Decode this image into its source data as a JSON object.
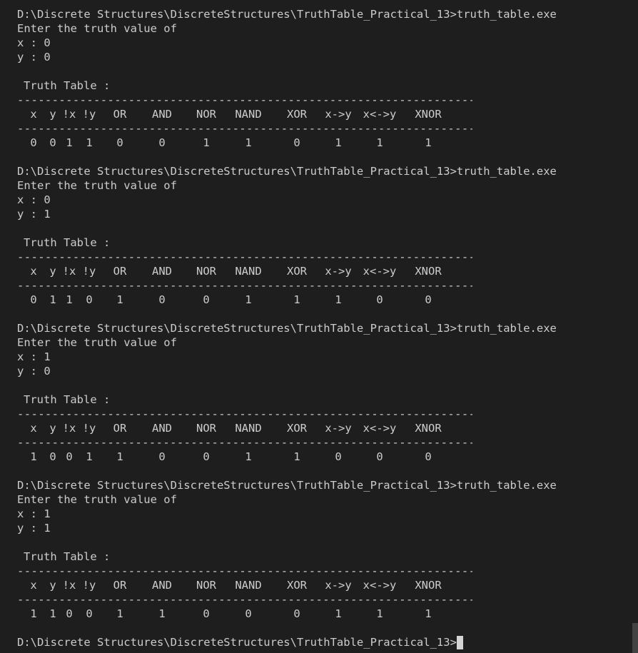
{
  "terminal": {
    "prompt": "D:\\Discrete Structures\\DiscreteStructures\\TruthTable_Practical_13>",
    "command": "truth_table.exe",
    "enter_prompt": "Enter the truth value of",
    "x_label": "x : ",
    "y_label": "y : ",
    "table_title": "Truth Table :",
    "separator": "------------------------------------------------------------------------------------------------------------",
    "headers": [
      "x",
      "y",
      "!x",
      "!y",
      "OR",
      "AND",
      "NOR",
      "NAND",
      "XOR",
      "x->y",
      "x<->y",
      "XNOR"
    ],
    "runs": [
      {
        "x": "0",
        "y": "0",
        "row": [
          "0",
          "0",
          "1",
          "1",
          "0",
          "0",
          "1",
          "1",
          "0",
          "1",
          "1",
          "1"
        ]
      },
      {
        "x": "0",
        "y": "1",
        "row": [
          "0",
          "1",
          "1",
          "0",
          "1",
          "0",
          "0",
          "1",
          "1",
          "1",
          "0",
          "0"
        ]
      },
      {
        "x": "1",
        "y": "0",
        "row": [
          "1",
          "0",
          "0",
          "1",
          "1",
          "0",
          "0",
          "1",
          "1",
          "0",
          "0",
          "0"
        ]
      },
      {
        "x": "1",
        "y": "1",
        "row": [
          "1",
          "1",
          "0",
          "0",
          "1",
          "1",
          "0",
          "0",
          "0",
          "1",
          "1",
          "1"
        ]
      }
    ]
  }
}
